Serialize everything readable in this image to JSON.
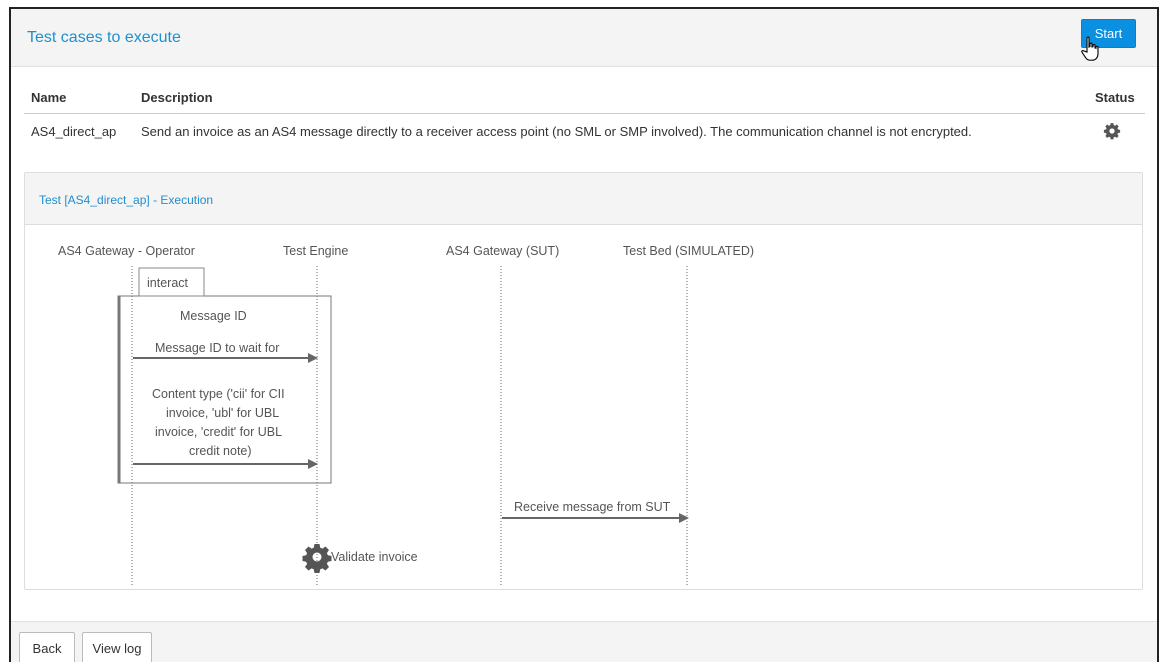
{
  "header": {
    "title": "Test cases to execute",
    "start_label": "Start"
  },
  "table": {
    "columns": {
      "name": "Name",
      "description": "Description",
      "status": "Status"
    },
    "rows": [
      {
        "name": "AS4_direct_ap",
        "description": "Send an invoice as an AS4 message directly to a receiver access point (no SML or SMP involved). The communication channel is not encrypted.",
        "status_icon": "gear-icon"
      }
    ]
  },
  "execution": {
    "title": "Test [AS4_direct_ap] - Execution",
    "lifelines": [
      "AS4 Gateway - Operator",
      "Test Engine",
      "AS4 Gateway (SUT)",
      "Test Bed (SIMULATED)"
    ],
    "group_label": "interact",
    "group_title": "Message ID",
    "messages": [
      {
        "lines": [
          "Message ID to wait for"
        ]
      },
      {
        "lines": [
          "Content type ('cii' for CII",
          "invoice, 'ubl' for UBL",
          "invoice, 'credit' for UBL",
          "credit note)"
        ]
      },
      {
        "lines": [
          "Receive message from SUT"
        ]
      }
    ],
    "step": {
      "label": "Validate invoice",
      "icon": "gear-icon"
    }
  },
  "footer": {
    "back_label": "Back",
    "view_log_label": "View log"
  }
}
